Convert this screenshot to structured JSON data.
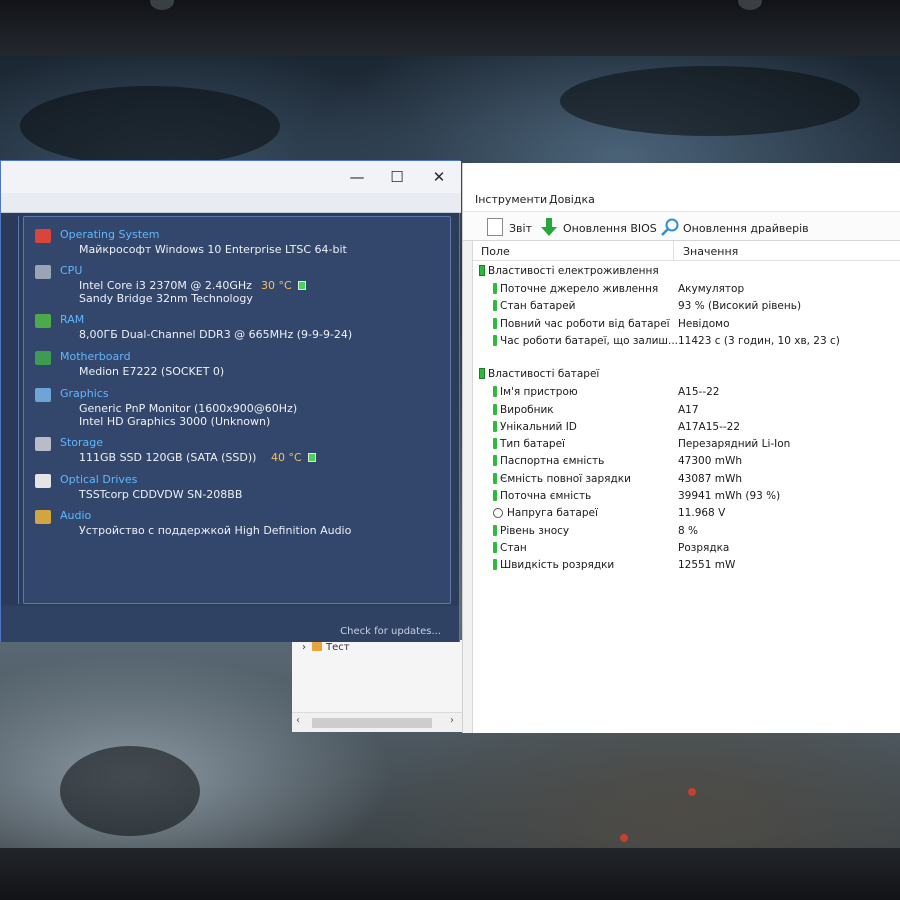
{
  "speccy": {
    "sections": [
      {
        "heading": "Operating System",
        "lines": [
          "Майкрософт Windows 10 Enterprise LTSC 64-bit"
        ],
        "icon": "windows-flag-icon",
        "color": "#d9453a"
      },
      {
        "heading": "CPU",
        "lines": [
          "Intel Core i3 2370M @ 2.40GHz",
          "Sandy Bridge 32nm Technology"
        ],
        "icon": "cpu-chip-icon",
        "color": "#9aa4b4",
        "temp": "30 °C"
      },
      {
        "heading": "RAM",
        "lines": [
          "8,00ГБ Dual-Channel DDR3 @ 665MHz (9-9-9-24)"
        ],
        "icon": "ram-stick-icon",
        "color": "#4caa4a"
      },
      {
        "heading": "Motherboard",
        "lines": [
          "Medion E7222 (SOCKET 0)"
        ],
        "icon": "motherboard-icon",
        "color": "#3d9b52"
      },
      {
        "heading": "Graphics",
        "lines": [
          "Generic PnP Monitor (1600x900@60Hz)",
          "Intel HD Graphics 3000 (Unknown)"
        ],
        "icon": "monitor-icon",
        "color": "#6fa4d8"
      },
      {
        "heading": "Storage",
        "lines": [
          "111GB SSD 120GB (SATA (SSD))"
        ],
        "icon": "hard-drive-icon",
        "color": "#b7bcc6",
        "temp": "40 °C"
      },
      {
        "heading": "Optical Drives",
        "lines": [
          "TSSTcorp CDDVDW SN-208BB"
        ],
        "icon": "optical-disc-icon",
        "color": "#e5e5e5"
      },
      {
        "heading": "Audio",
        "lines": [
          "Устройство с поддержкой High Definition Audio"
        ],
        "icon": "speaker-icon",
        "color": "#d2a540"
      }
    ],
    "footer_link": "Check for updates..."
  },
  "window_controls": {
    "minimize": "—",
    "maximize": "☐",
    "close": "✕"
  },
  "tree": {
    "item": "Тест"
  },
  "aida": {
    "menu": [
      "Інструменти",
      "Довідка"
    ],
    "toolbar": {
      "report": "Звіт",
      "bios_update": "Оновлення BIOS",
      "driver_update": "Оновлення драйверів"
    },
    "columns": {
      "field": "Поле",
      "value": "Значення"
    },
    "groups": [
      {
        "title": "Властивості електроживлення",
        "rows": [
          {
            "field": "Поточне джерело живлення",
            "value": "Акумулятор",
            "icon": "plug"
          },
          {
            "field": "Стан батарей",
            "value": "93 % (Високий рівень)",
            "icon": "plug"
          },
          {
            "field": "Повний час роботи від батареї",
            "value": "Невідомо",
            "icon": "plug"
          },
          {
            "field": "Час роботи батареї, що залиш...",
            "value": "11423 с (3 годин, 10 хв, 23 с)",
            "icon": "plug"
          }
        ]
      },
      {
        "title": "Властивості батареї",
        "rows": [
          {
            "field": "Ім'я пристрою",
            "value": "A15--22",
            "icon": "plug"
          },
          {
            "field": "Виробник",
            "value": "A17",
            "icon": "plug"
          },
          {
            "field": "Унікальний ID",
            "value": "A17A15--22",
            "icon": "plug"
          },
          {
            "field": "Тип батареї",
            "value": "Перезарядний Li-Ion",
            "icon": "plug"
          },
          {
            "field": "Паспортна ємність",
            "value": "47300 mWh",
            "icon": "plug"
          },
          {
            "field": "Ємність повної зарядки",
            "value": "43087 mWh",
            "icon": "plug"
          },
          {
            "field": "Поточна ємність",
            "value": "39941 mWh  (93 %)",
            "icon": "plug"
          },
          {
            "field": "Напруга батареї",
            "value": "11.968 V",
            "icon": "volt"
          },
          {
            "field": "Рівень зносу",
            "value": "8 %",
            "icon": "plug"
          },
          {
            "field": "Стан",
            "value": "Розрядка",
            "icon": "plug"
          },
          {
            "field": "Швидкість розрядки",
            "value": "12551 mW",
            "icon": "plug"
          }
        ]
      }
    ]
  },
  "colors": {
    "speccy_bg": "#2c3d5c",
    "speccy_heading": "#5fb8ff",
    "temp": "#f1c35a",
    "battery_green": "#2dbb3a"
  }
}
